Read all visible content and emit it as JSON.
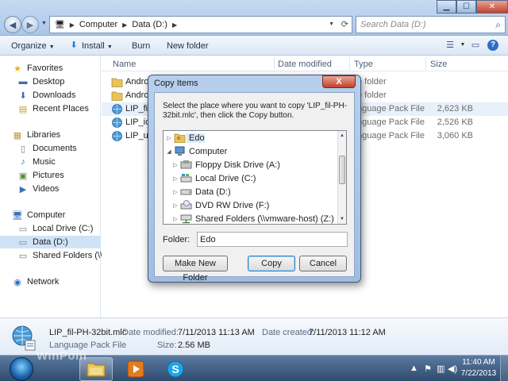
{
  "address": {
    "segments": [
      "Computer",
      "Data (D:)"
    ]
  },
  "search": {
    "placeholder": "Search Data (D:)"
  },
  "toolbar": {
    "organize": "Organize",
    "install": "Install",
    "burn": "Burn",
    "new_folder": "New folder"
  },
  "sidebar": {
    "favorites": "Favorites",
    "desktop": "Desktop",
    "downloads": "Downloads",
    "recent": "Recent Places",
    "libraries": "Libraries",
    "documents": "Documents",
    "music": "Music",
    "pictures": "Pictures",
    "videos": "Videos",
    "computer": "Computer",
    "local_drive": "Local Drive (C:)",
    "data_drive": "Data (D:)",
    "shared": "Shared Folders (\\\\vn",
    "network": "Network"
  },
  "columns": {
    "name": "Name",
    "date": "Date modified",
    "type": "Type",
    "size": "Size"
  },
  "files": [
    {
      "name": "Andro",
      "type": "e folder",
      "size": ""
    },
    {
      "name": "Andro",
      "type": "e folder",
      "size": ""
    },
    {
      "name": "LIP_fil-",
      "type": "nguage Pack File",
      "size": "2,623 KB"
    },
    {
      "name": "LIP_id-",
      "type": "nguage Pack File",
      "size": "2,526 KB"
    },
    {
      "name": "LIP_ur-",
      "type": "nguage Pack File",
      "size": "3,060 KB"
    }
  ],
  "details": {
    "filename": "LIP_fil-PH-32bit.mlc",
    "filetype": "Language Pack File",
    "date_modified_label": "Date modified:",
    "date_modified": "7/11/2013 11:13 AM",
    "date_created_label": "Date created:",
    "date_created": "7/11/2013 11:12 AM",
    "size_label": "Size:",
    "size": "2.56 MB"
  },
  "dialog": {
    "title": "Copy Items",
    "close": "X",
    "instruction": "Select the place where you want to copy 'LIP_fil-PH-32bit.mlc', then click the Copy button.",
    "tree": [
      {
        "label": "Edo",
        "indent": 0,
        "expanded": false,
        "icon": "user-folder-icon"
      },
      {
        "label": "Computer",
        "indent": 0,
        "expanded": true,
        "icon": "computer-icon"
      },
      {
        "label": "Floppy Disk Drive (A:)",
        "indent": 1,
        "expanded": false,
        "icon": "floppy-icon"
      },
      {
        "label": "Local Drive (C:)",
        "indent": 1,
        "expanded": false,
        "icon": "drive-icon"
      },
      {
        "label": "Data (D:)",
        "indent": 1,
        "expanded": false,
        "icon": "drive-icon"
      },
      {
        "label": "DVD RW Drive (F:)",
        "indent": 1,
        "expanded": false,
        "icon": "dvd-icon"
      },
      {
        "label": "Shared Folders (\\\\vmware-host) (Z:)",
        "indent": 1,
        "expanded": false,
        "icon": "network-drive-icon"
      }
    ],
    "folder_label": "Folder:",
    "folder_value": "Edo",
    "new_folder_button": "Make New Folder",
    "copy_button": "Copy",
    "cancel_button": "Cancel"
  },
  "taskbar": {
    "watermark": "WinPoin",
    "time": "11:40 AM",
    "date": "7/22/2013"
  }
}
